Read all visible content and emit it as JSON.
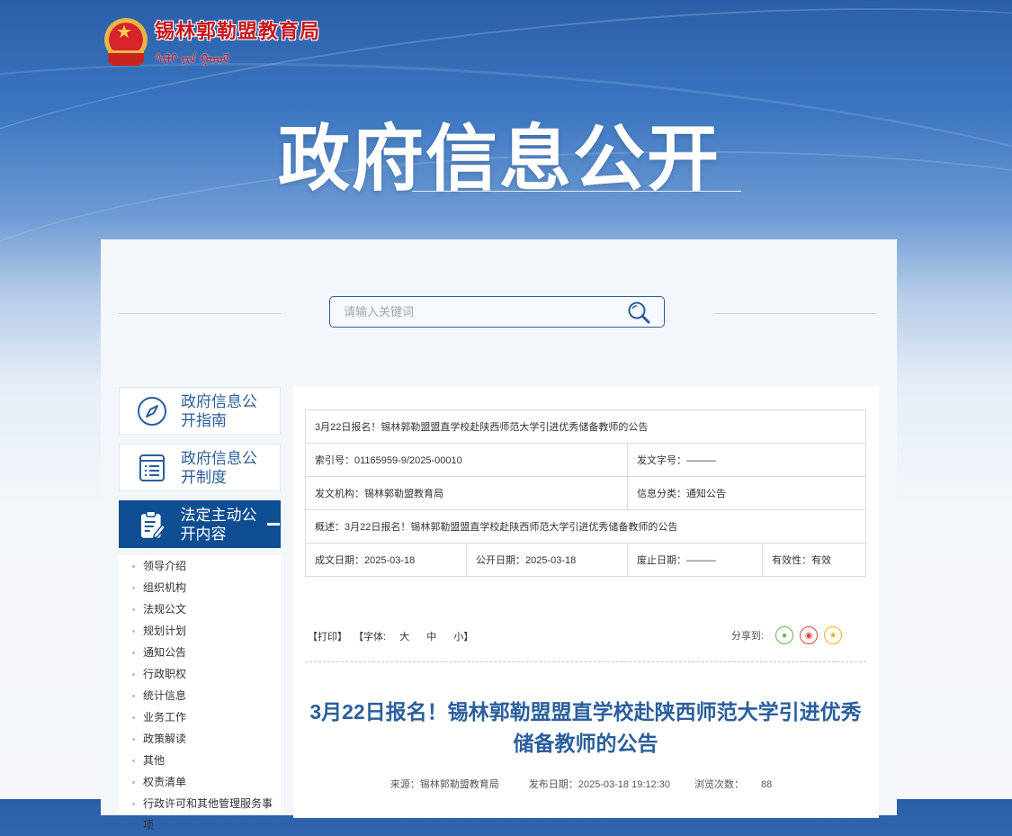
{
  "logo": {
    "name_cn": "锡林郭勒盟教育局",
    "name_mn": "ᠰᠢᠯᠢ ᠶᠢᠨ ᠭᠣᠣᠯ"
  },
  "hero": {
    "title": "政府信息公开"
  },
  "search": {
    "placeholder": "请输入关键词"
  },
  "sidebar": {
    "cards": [
      {
        "label": "政府信息公开指南",
        "icon": "compass-icon"
      },
      {
        "label": "政府信息公开制度",
        "icon": "list-document-icon"
      },
      {
        "label": "法定主动公开内容",
        "icon": "clipboard-edit-icon",
        "active": true
      }
    ],
    "items": [
      "领导介绍",
      "组织机构",
      "法规公文",
      "规划计划",
      "通知公告",
      "行政职权",
      "统计信息",
      "业务工作",
      "政策解读",
      "其他",
      "权责清单",
      "行政许可和其他管理服务事项"
    ]
  },
  "info_table": {
    "title": "3月22日报名！锡林郭勒盟盟直学校赴陕西师范大学引进优秀储备教师的公告",
    "index_no": "索引号：01165959-9/2025-00010",
    "doc_no": "发文字号：———",
    "agency": "发文机构：锡林郭勒盟教育局",
    "category": "信息分类：通知公告",
    "summary": "概述：3月22日报名！锡林郭勒盟盟直学校赴陕西师范大学引进优秀储备教师的公告",
    "created": "成文日期：2025-03-18",
    "published": "公开日期：2025-03-18",
    "abolished": "废止日期：———",
    "validity": "有效性：有效"
  },
  "tools": {
    "print": "【打印】",
    "font_prefix": "【字体:",
    "font_large": "大",
    "font_mid": "中",
    "font_small": "小】",
    "share_label": "分享到:"
  },
  "article": {
    "title": "3月22日报名！锡林郭勒盟盟直学校赴陕西师范大学引进优秀储备教师的公告",
    "source": "来源：锡林郭勒盟教育局",
    "publish_time": "发布日期：2025-03-18 19:12:30",
    "views_label": "浏览次数：",
    "views": "88"
  }
}
